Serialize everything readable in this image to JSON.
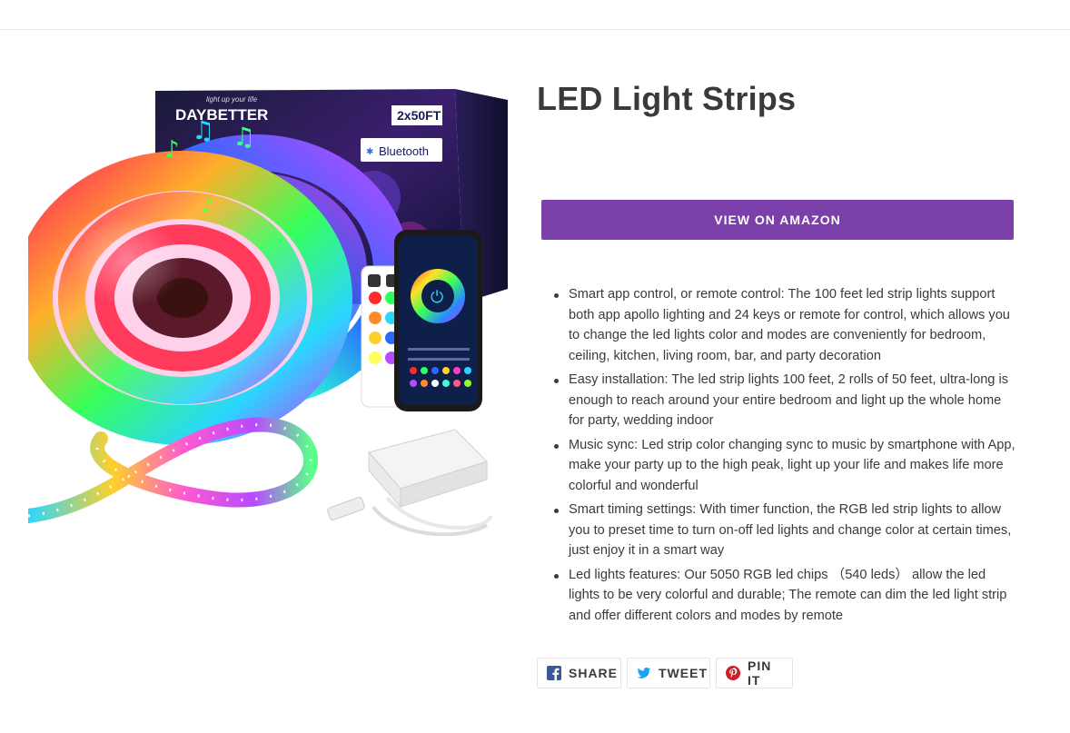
{
  "product": {
    "title": "LED Light Strips",
    "image": {
      "brand": "DAYBETTER",
      "tagline": "light up your life",
      "size_badge": "2x50FT",
      "connectivity_badge": "Bluetooth"
    },
    "cta_label": "VIEW ON AMAZON",
    "features": [
      "Smart app control, or remote control: The 100 feet led strip lights support both app apollo lighting and 24 keys or remote for control, which allows you to change the led lights color and modes are conveniently for bedroom, ceiling, kitchen, living room, bar, and party decoration",
      "Easy installation: The led strip lights 100 feet, 2 rolls of 50 feet, ultra-long is enough to reach around your entire bedroom and light up the whole home for party, wedding indoor",
      "Music sync: Led strip color changing sync to music by smartphone with App, make your party up to the high peak, light up your life and makes life more colorful and wonderful",
      "Smart timing settings: With timer function, the RGB led strip lights to allow you to preset time to turn on-off led lights and change color at certain times, just enjoy it in a smart way",
      "Led lights features: Our 5050 RGB led chips （540 leds） allow the led lights to be very colorful and durable; The remote can dim the led light strip and offer different colors and modes by remote"
    ]
  },
  "share": {
    "facebook": {
      "label": "SHARE",
      "icon": "facebook-icon",
      "color": "#3b5998"
    },
    "twitter": {
      "label": "TWEET",
      "icon": "twitter-icon",
      "color": "#1da1f2"
    },
    "pinterest": {
      "label": "PIN IT",
      "icon": "pinterest-icon",
      "color": "#cb2027"
    }
  },
  "colors": {
    "accent": "#7a3fa9",
    "text": "#3a3a3a",
    "divider": "#e8e8e8"
  }
}
